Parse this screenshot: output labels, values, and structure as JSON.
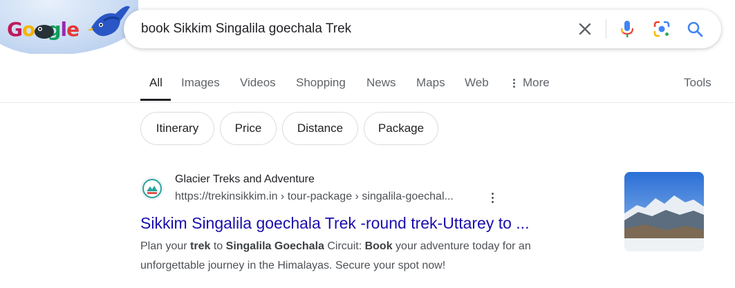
{
  "doodle": {
    "logo_text": "Google"
  },
  "search": {
    "query": "book Sikkim Singalila goechala Trek"
  },
  "icons": {
    "clear": "close-icon",
    "voice": "microphone-icon",
    "lens": "camera-lens-icon",
    "search": "search-icon",
    "more": "vertical-dots-icon"
  },
  "tabs": [
    {
      "label": "All"
    },
    {
      "label": "Images"
    },
    {
      "label": "Videos"
    },
    {
      "label": "Shopping"
    },
    {
      "label": "News"
    },
    {
      "label": "Maps"
    },
    {
      "label": "Web"
    },
    {
      "label": "More"
    },
    {
      "label": "Tools"
    }
  ],
  "chips": [
    {
      "label": "Itinerary"
    },
    {
      "label": "Price"
    },
    {
      "label": "Distance"
    },
    {
      "label": "Package"
    }
  ],
  "result": {
    "site_name": "Glacier Treks and Adventure",
    "url": "https://trekinsikkim.in › tour-package › singalila-goechal...",
    "title": "Sikkim Singalila goechala Trek -round trek-Uttarey to ...",
    "snippet_parts": [
      {
        "text": "Plan your ",
        "bold": false
      },
      {
        "text": "trek",
        "bold": true
      },
      {
        "text": " to ",
        "bold": false
      },
      {
        "text": "Singalila Goechala",
        "bold": true
      },
      {
        "text": " Circuit: ",
        "bold": false
      },
      {
        "text": "Book",
        "bold": true
      },
      {
        "text": " your adventure today for an unforgettable journey in the Himalayas. Secure your spot now!",
        "bold": false
      }
    ]
  },
  "colors": {
    "link": "#1a0dab",
    "tab_active": "#202124",
    "tab_inactive": "#5f6368",
    "google_blue": "#4285f4",
    "google_red": "#ea4335",
    "google_yellow": "#fbbc04",
    "google_green": "#34a853"
  }
}
